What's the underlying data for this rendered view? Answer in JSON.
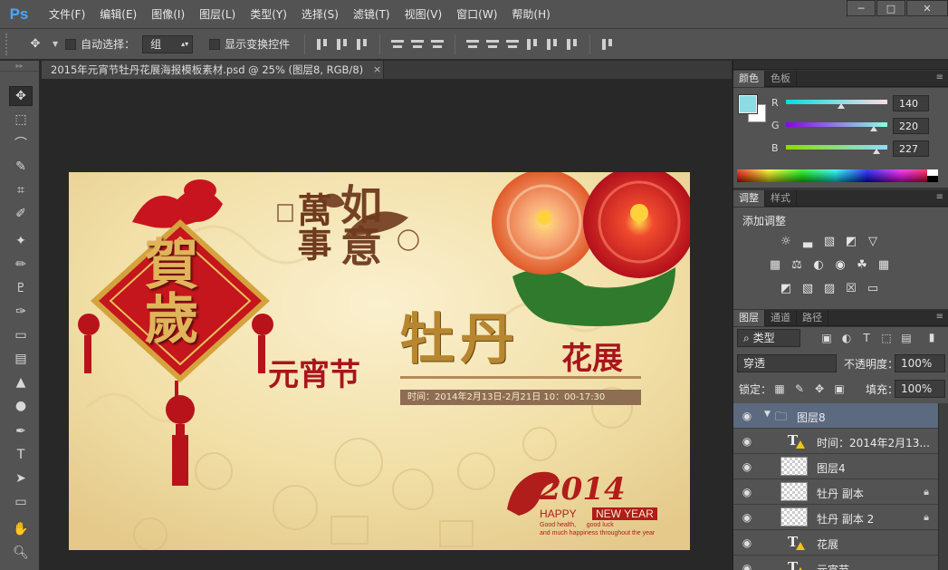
{
  "app": {
    "logo": "Ps"
  },
  "menu": [
    "文件(F)",
    "编辑(E)",
    "图像(I)",
    "图层(L)",
    "类型(Y)",
    "选择(S)",
    "滤镜(T)",
    "视图(V)",
    "窗口(W)",
    "帮助(H)"
  ],
  "window_controls": {
    "minimize": "─",
    "maximize": "□",
    "close": "✕"
  },
  "options": {
    "auto_select_label": "自动选择：",
    "auto_select_value": "组",
    "show_transform_label": "显示变换控件"
  },
  "document": {
    "tab_title": "2015年元宵节牡丹花展海报模板素材.psd @ 25% (图层8, RGB/8)",
    "tab_close": "×"
  },
  "artwork": {
    "he_sui": "賀歲",
    "wan_shi": "萬事",
    "ru_yi": "如意",
    "yuan_xiao": "元宵节",
    "mu_dan": "牡丹",
    "hua_zhan": "花展",
    "time_text": "时间：2014年2月13日-2月21日 10：00-17:30",
    "year": "2014",
    "happy": "HAPPY",
    "new_year": "NEW YEAR",
    "wish_1": "Good health,      good luck",
    "wish_2": "and much happiness throughout the year"
  },
  "color_panel": {
    "tabs": [
      "颜色",
      "色板"
    ],
    "fg_color": "#8cdce3",
    "channels": [
      {
        "label": "R",
        "value": "140",
        "level": 0.549
      },
      {
        "label": "G",
        "value": "220",
        "level": 0.863
      },
      {
        "label": "B",
        "value": "227",
        "level": 0.89
      }
    ]
  },
  "adjust_panel": {
    "tabs": [
      "调整",
      "样式"
    ],
    "title": "添加调整"
  },
  "layers_panel": {
    "tabs": [
      "图层",
      "通道",
      "路径"
    ],
    "filter_label": "类型",
    "blend_mode": "穿透",
    "opacity_label": "不透明度：",
    "opacity_value": "100%",
    "lock_label": "锁定：",
    "fill_label": "填充：",
    "fill_value": "100%",
    "layers": [
      {
        "name": "图层8",
        "kind": "group",
        "selected": true
      },
      {
        "name": "时间：2014年2月13...",
        "kind": "text"
      },
      {
        "name": "图层4",
        "kind": "pixel"
      },
      {
        "name": "牡丹 副本",
        "kind": "pixel",
        "locked": true
      },
      {
        "name": "牡丹 副本 2",
        "kind": "pixel",
        "locked": true
      },
      {
        "name": "花展",
        "kind": "text"
      },
      {
        "name": "元宵节",
        "kind": "text"
      }
    ]
  }
}
